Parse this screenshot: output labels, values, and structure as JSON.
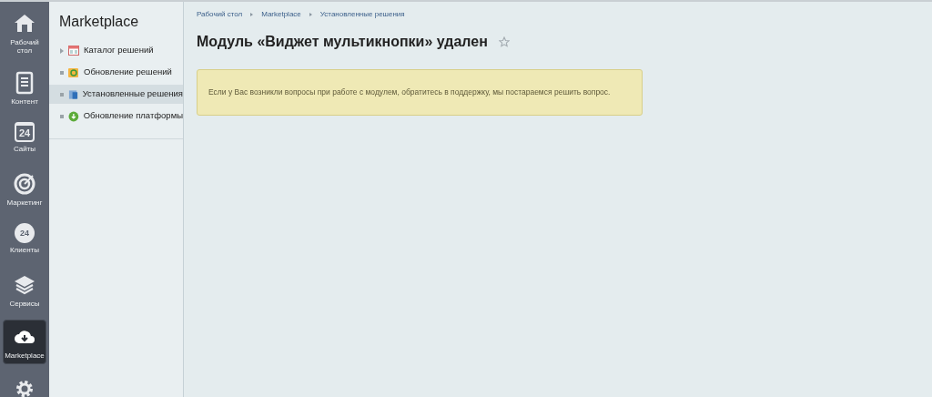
{
  "nav": [
    {
      "kind": "home",
      "label": "Рабочий стол",
      "selected": false
    },
    {
      "kind": "document",
      "label": "Контент",
      "selected": false
    },
    {
      "kind": "calendar",
      "label": "Сайты",
      "icon_text": "24",
      "selected": false
    },
    {
      "kind": "target",
      "label": "Маркетинг",
      "selected": false
    },
    {
      "kind": "badge",
      "label": "Клиенты",
      "icon_text": "24",
      "selected": false
    },
    {
      "kind": "layers",
      "label": "Сервисы",
      "selected": false
    },
    {
      "kind": "cloud",
      "label": "Marketplace",
      "selected": true
    },
    {
      "kind": "gear",
      "selected": false
    }
  ],
  "sidebar": {
    "title": "Marketplace",
    "items": [
      {
        "kind": "folder",
        "label": "Каталог решений",
        "selected": false
      },
      {
        "kind": "leaf",
        "label": "Обновление решений",
        "selected": false
      },
      {
        "kind": "leaf",
        "label": "Установленные решения",
        "selected": true
      },
      {
        "kind": "leaf",
        "label": "Обновление платформы",
        "selected": false
      }
    ]
  },
  "breadcrumbs": [
    "Рабочий стол",
    "Marketplace",
    "Установленные решения"
  ],
  "title": "Модуль «Виджет мультикнопки» удален",
  "favorite": false,
  "notice": "Если у Вас возникли вопросы при работе с модулем, обратитесь в поддержку, мы постараемся решить вопрос."
}
